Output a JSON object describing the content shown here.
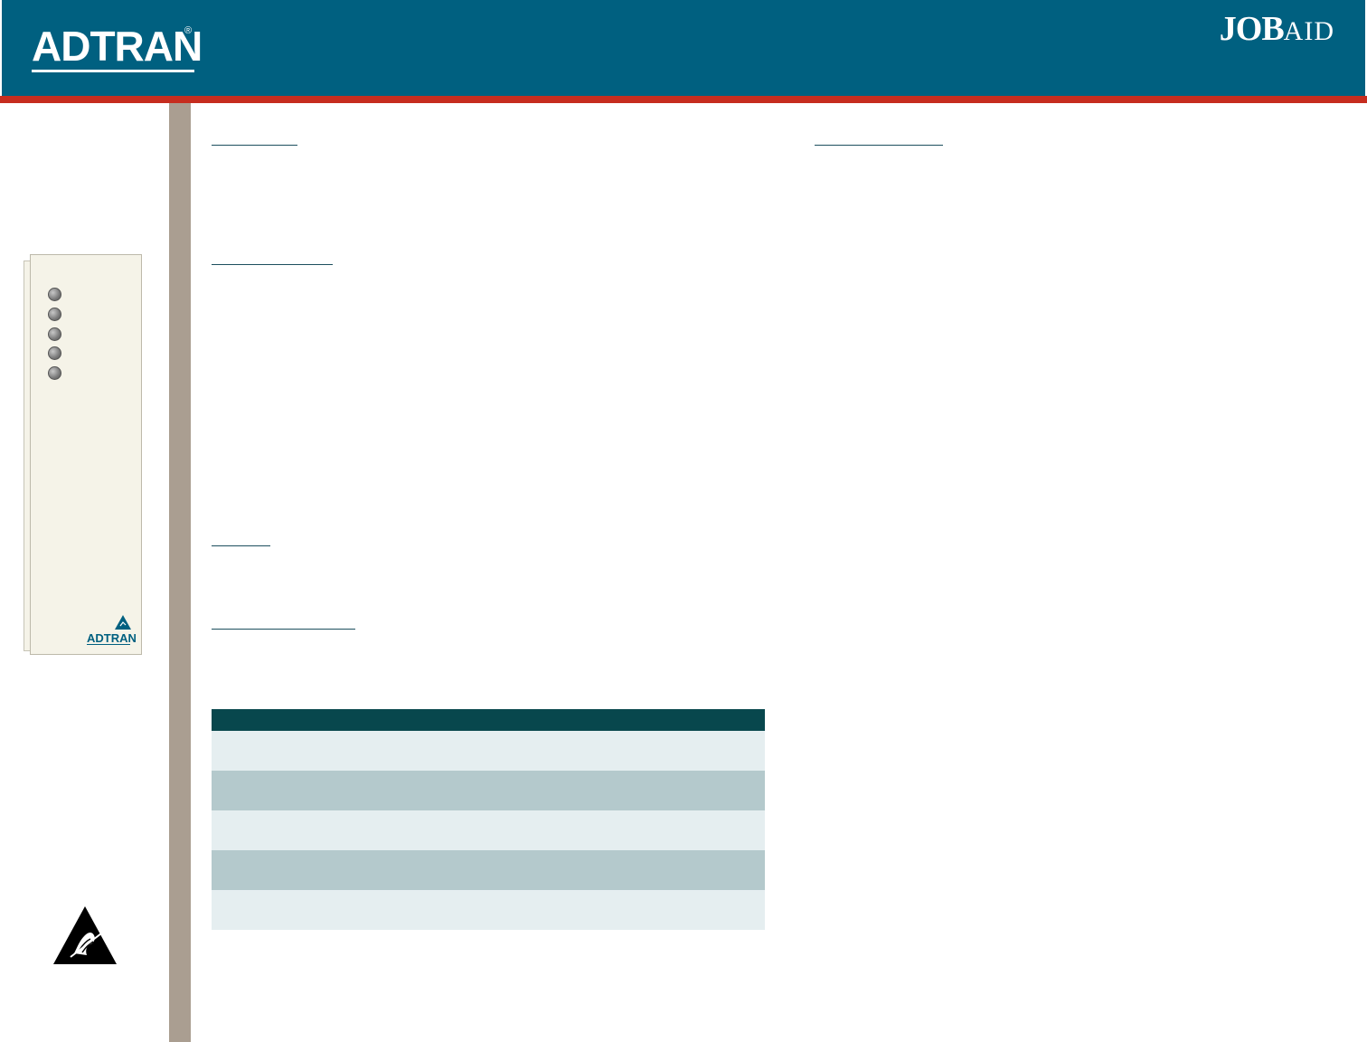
{
  "header": {
    "logo_text": "ADTRAN",
    "logo_registered": "®",
    "jobaid_bold": "JOB",
    "jobaid_rest": "AID"
  },
  "card": {
    "logo_text": "ADTRAN",
    "led_count": 5
  },
  "colors": {
    "header_bg": "#006080",
    "header_rule": "#c62d1f",
    "side_bar": "#aa9e91",
    "table_header": "#08474d",
    "row_light": "#e5eef0",
    "row_dark": "#b4c9cc"
  },
  "icons": [
    "esd-warning-icon",
    "led-indicator-icon",
    "adtran-logo"
  ],
  "table": {
    "header": [],
    "rows": [
      [],
      [],
      [],
      [],
      []
    ]
  }
}
